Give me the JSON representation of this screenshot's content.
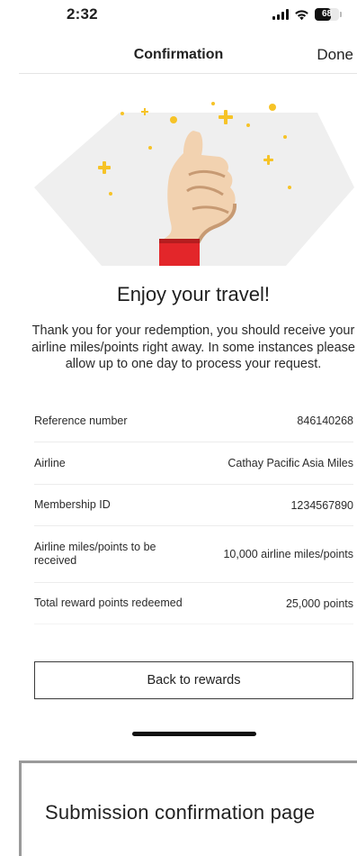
{
  "status_bar": {
    "time": "2:32",
    "battery": "68"
  },
  "nav": {
    "title": "Confirmation",
    "done_label": "Done"
  },
  "colors": {
    "accent_sparkle": "#f6c327",
    "cuff_red": "#e3262a",
    "hexagon_bg": "#efefef",
    "skin": "#f2d2b0"
  },
  "confirmation": {
    "heading": "Enjoy your travel!",
    "message": "Thank you for your redemption, you should receive your airline miles/points right away. In some instances please allow up to one day to process your request."
  },
  "details": [
    {
      "label": "Reference number",
      "value": "846140268"
    },
    {
      "label": "Airline",
      "value": "Cathay Pacific Asia Miles"
    },
    {
      "label": "Membership ID",
      "value": "1234567890"
    },
    {
      "label": "Airline miles/points to be received",
      "value": "10,000 airline miles/points"
    },
    {
      "label": "Total reward points redeemed",
      "value": "25,000 points"
    }
  ],
  "actions": {
    "back_label": "Back to rewards"
  },
  "caption": {
    "text": "Submission confirmation page"
  }
}
